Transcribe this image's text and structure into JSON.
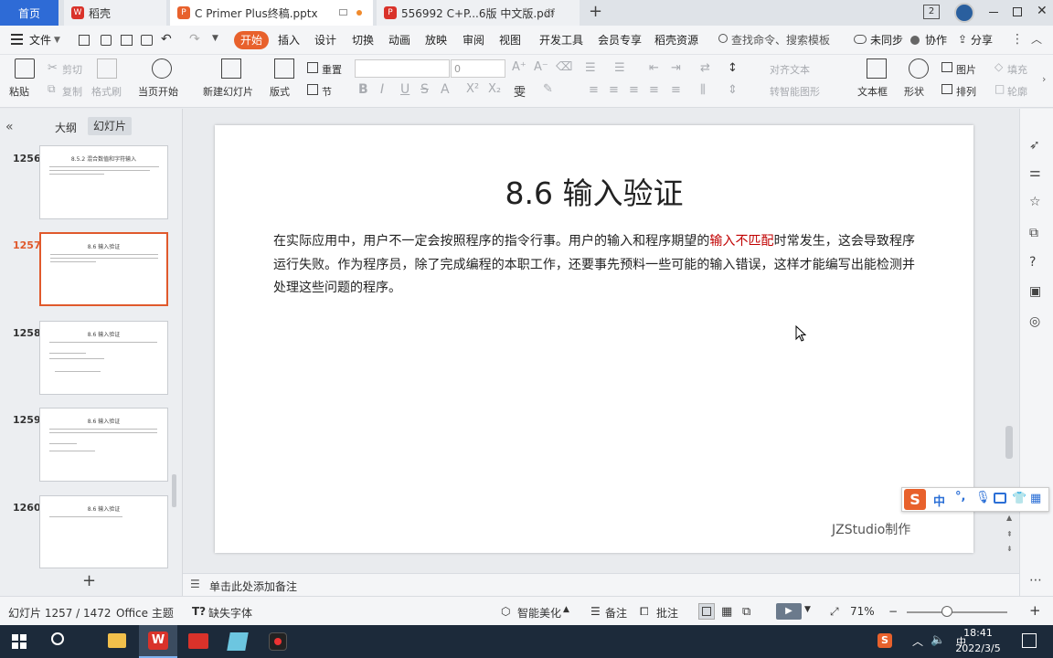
{
  "tabs": [
    {
      "label": "首页"
    },
    {
      "label": "稻壳"
    },
    {
      "label": "C Primer  Plus终稿.pptx"
    },
    {
      "label": "556992 C+P...6版 中文版.pdf"
    }
  ],
  "window": {
    "counter": "2"
  },
  "menu": {
    "file": "文件",
    "items": [
      "开始",
      "插入",
      "设计",
      "切换",
      "动画",
      "放映",
      "审阅",
      "视图",
      "开发工具",
      "会员专享",
      "稻壳资源"
    ],
    "search": "查找命令、搜索模板",
    "sync": "未同步",
    "collab": "协作",
    "share": "分享"
  },
  "ribbon": {
    "paste": "粘贴",
    "cut": "剪切",
    "copy": "复制",
    "format_painter": "格式刷",
    "play_from_current": "当页开始",
    "new_slide": "新建幻灯片",
    "layout": "版式",
    "reset": "重置",
    "section": "节",
    "font_size": "0",
    "align_text": "对齐文本",
    "smart_shape": "转智能图形",
    "textbox": "文本框",
    "shape": "形状",
    "picture": "图片",
    "arrange": "排列",
    "fill": "填充",
    "outline": "轮廓"
  },
  "leftpane": {
    "outline_tab": "大纲",
    "slides_tab": "幻灯片",
    "slides": [
      {
        "num": "1256",
        "title": "8.5.2 混合数值和字符输入"
      },
      {
        "num": "1257",
        "title": "8.6 输入验证"
      },
      {
        "num": "1258",
        "title": "8.6 输入验证"
      },
      {
        "num": "1259",
        "title": "8.6 输入验证"
      },
      {
        "num": "1260",
        "title": "8.6 输入验证"
      }
    ]
  },
  "slide": {
    "title": "8.6 输入验证",
    "para_before": "在实际应用中，用户不一定会按照程序的指令行事。用户的输入和程序期望的",
    "para_highlight": "输入不匹配",
    "para_after": "时常发生，这会导致程序运行失败。作为程序员，除了完成编程的本职工作，还要事先预料一些可能的输入错误，这样才能编写出能检测并处理这些问题的程序。",
    "footer": "JZStudio制作"
  },
  "notes": {
    "placeholder": "单击此处添加备注"
  },
  "status": {
    "slide_info": "幻灯片 1257 / 1472",
    "theme": "Office 主题",
    "missing_font": "缺失字体",
    "beautify": "智能美化",
    "notes": "备注",
    "comment": "批注",
    "zoom": "71%"
  },
  "ime": {
    "lang": "中"
  },
  "clock": {
    "time": "18:41",
    "date": "2022/3/5"
  },
  "colors": {
    "accent": "#e8612c",
    "highlight": "#c00000",
    "taskbar": "#1c2a3a"
  }
}
